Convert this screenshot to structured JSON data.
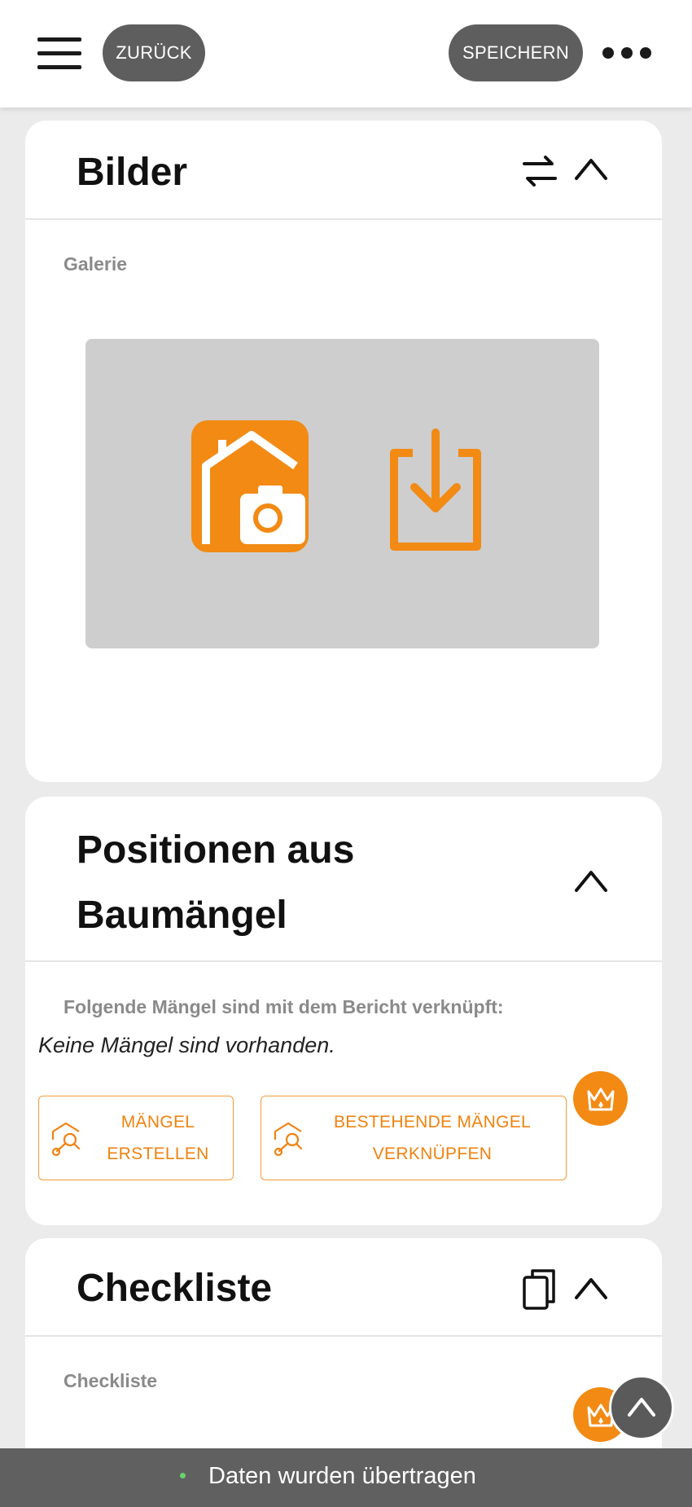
{
  "header": {
    "back_label": "ZURÜCK",
    "save_label": "SPEICHERN"
  },
  "bilder": {
    "title": "Bilder",
    "gallery_label": "Galerie"
  },
  "positionen": {
    "title_line1": "Positionen aus",
    "title_line2": "Baumängel",
    "linked_label": "Folgende Mängel sind mit dem Bericht verknüpft:",
    "empty_text": "Keine Mängel sind vorhanden.",
    "create_line1": "MÄNGEL",
    "create_line2": "ERSTELLEN",
    "link_line1": "BESTEHENDE MÄNGEL",
    "link_line2": "VERKNÜPFEN"
  },
  "checkliste": {
    "title": "Checkliste",
    "label": "Checkliste"
  },
  "toast": {
    "message": "Daten wurden übertragen"
  },
  "colors": {
    "accent": "#f28a14",
    "pill_bg": "#5e5e5e",
    "toast_bg": "#606060",
    "toast_dot": "#67d36b"
  },
  "icons": [
    "menu-icon",
    "more-icon",
    "swap-icon",
    "chevron-up-icon",
    "house-camera-icon",
    "download-icon",
    "search-pin-icon",
    "crown-icon",
    "copy-icon"
  ]
}
